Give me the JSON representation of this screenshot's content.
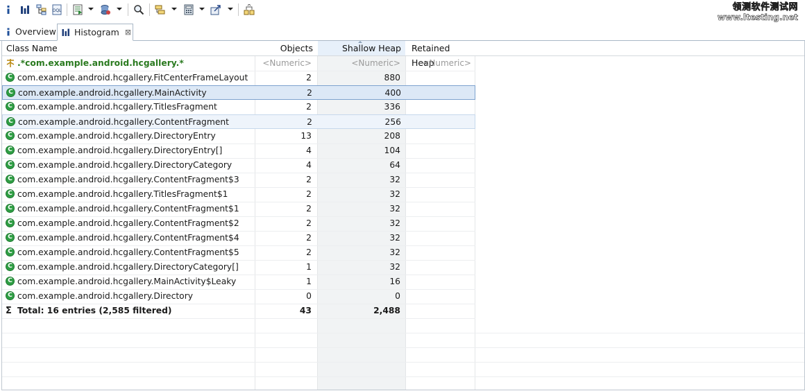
{
  "watermark": {
    "line1": "领测软件测试网",
    "line2": "www.ltesting.net"
  },
  "tabs": [
    {
      "label": "Overview",
      "icon": "info-icon",
      "active": false
    },
    {
      "label": "Histogram",
      "icon": "histogram-icon",
      "active": true,
      "close": "⊠"
    }
  ],
  "table": {
    "columns": [
      "Class Name",
      "Objects",
      "Shallow Heap",
      "Retained Heap"
    ],
    "sorted_column": "Shallow Heap",
    "filter_row": {
      "name": ".*com.example.android.hcgallery.*",
      "objects": "<Numeric>",
      "shallow": "<Numeric>",
      "retained": "<Numeric>"
    },
    "rows": [
      {
        "name": "com.example.android.hcgallery.FitCenterFrameLayout",
        "objects": "2",
        "shallow": "880"
      },
      {
        "name": "com.example.android.hcgallery.MainActivity",
        "objects": "2",
        "shallow": "400"
      },
      {
        "name": "com.example.android.hcgallery.TitlesFragment",
        "objects": "2",
        "shallow": "336"
      },
      {
        "name": "com.example.android.hcgallery.ContentFragment",
        "objects": "2",
        "shallow": "256"
      },
      {
        "name": "com.example.android.hcgallery.DirectoryEntry",
        "objects": "13",
        "shallow": "208"
      },
      {
        "name": "com.example.android.hcgallery.DirectoryEntry[]",
        "objects": "4",
        "shallow": "104"
      },
      {
        "name": "com.example.android.hcgallery.DirectoryCategory",
        "objects": "4",
        "shallow": "64"
      },
      {
        "name": "com.example.android.hcgallery.ContentFragment$3",
        "objects": "2",
        "shallow": "32"
      },
      {
        "name": "com.example.android.hcgallery.TitlesFragment$1",
        "objects": "2",
        "shallow": "32"
      },
      {
        "name": "com.example.android.hcgallery.ContentFragment$1",
        "objects": "2",
        "shallow": "32"
      },
      {
        "name": "com.example.android.hcgallery.ContentFragment$2",
        "objects": "2",
        "shallow": "32"
      },
      {
        "name": "com.example.android.hcgallery.ContentFragment$4",
        "objects": "2",
        "shallow": "32"
      },
      {
        "name": "com.example.android.hcgallery.ContentFragment$5",
        "objects": "2",
        "shallow": "32"
      },
      {
        "name": "com.example.android.hcgallery.DirectoryCategory[]",
        "objects": "1",
        "shallow": "32"
      },
      {
        "name": "com.example.android.hcgallery.MainActivity$Leaky",
        "objects": "1",
        "shallow": "16"
      },
      {
        "name": "com.example.android.hcgallery.Directory",
        "objects": "0",
        "shallow": "0"
      }
    ],
    "selected_row": "com.example.android.hcgallery.MainActivity",
    "total": {
      "symbol": "Σ",
      "label": "Total: 16 entries (2,585 filtered)",
      "objects": "43",
      "shallow": "2,488"
    }
  },
  "colors": {
    "class_icon": "#2f9e44",
    "regex_text": "#2a7a1f",
    "selection": "#dce8f6",
    "sorted_column": "#f1f3f4"
  }
}
